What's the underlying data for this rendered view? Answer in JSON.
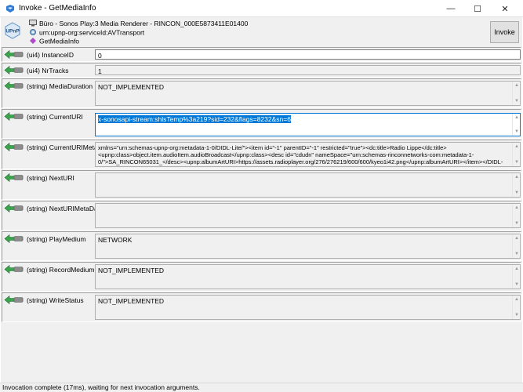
{
  "window": {
    "title": "Invoke - GetMediaInfo",
    "minimize_glyph": "—",
    "maximize_glyph": "☐",
    "close_glyph": "✕"
  },
  "header": {
    "logo_text": "UPnP",
    "device": "Büro - Sonos Play:3 Media Renderer - RINCON_000E5873411E01400",
    "service": "urn:upnp-org:serviceId:AVTransport",
    "action": "GetMediaInfo",
    "invoke_label": "Invoke"
  },
  "arguments": [
    {
      "label": "(ui4) InstanceID",
      "value": "0"
    },
    {
      "label": "(ui4) NrTracks",
      "value": "1"
    },
    {
      "label": "(string) MediaDuration",
      "value": "NOT_IMPLEMENTED"
    },
    {
      "label": "(string) CurrentURI",
      "value": "x-sonosapi-stream:shlsTemp%3a219?sid=232&flags=8232&sn=6"
    },
    {
      "label": "(string) CurrentURIMetaData",
      "value": "xmlns=\"urn:schemas-upnp-org:metadata-1-0/DIDL-Lite/\"><item id=\"-1\" parentID=\"-1\" restricted=\"true\"><dc:title>Radio Lippe</dc:title><upnp:class>object.item.audioItem.audioBroadcast</upnp:class><desc id=\"cdudn\" nameSpace=\"urn:schemas-rinconnetworks-com:metadata-1-0/\">SA_RINCON65031_</desc><upnp:albumArtURI>https://assets.radioplayer.org/276/276219/600/600/kyeo1i42.png</upnp:albumArtURI></item></DIDL-Lite>"
    },
    {
      "label": "(string) NextURI",
      "value": ""
    },
    {
      "label": "(string) NextURIMetaData",
      "value": ""
    },
    {
      "label": "(string) PlayMedium",
      "value": "NETWORK"
    },
    {
      "label": "(string) RecordMedium",
      "value": "NOT_IMPLEMENTED"
    },
    {
      "label": "(string) WriteStatus",
      "value": "NOT_IMPLEMENTED"
    }
  ],
  "status": "Invocation complete (17ms), waiting for next invocation arguments.",
  "colors": {
    "selection": "#0078d7",
    "arrow": "#3aa64b",
    "arrow_body": "#8c8c8c"
  },
  "icons": {
    "app": "upnp-invoke-icon",
    "arrow": "argument-out-arrow-icon",
    "device": "device-icon",
    "service": "service-gear-icon",
    "action": "action-icon"
  }
}
